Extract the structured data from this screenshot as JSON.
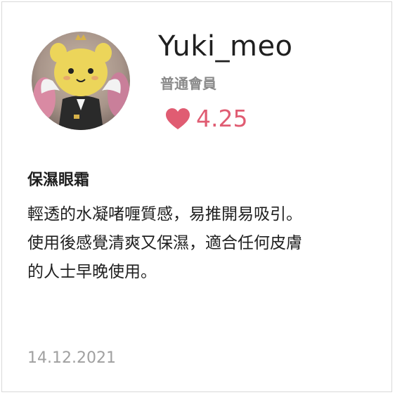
{
  "user": {
    "name": "Yuki_meo",
    "member_type": "普通會員",
    "rating": "4.25",
    "avatar": "yellow-bear-plush-avatar"
  },
  "review": {
    "title": "保濕眼霜",
    "body": "輕透的水凝啫喱質感，易推開易吸引。\n使用後感覺清爽又保濕，適合任何皮膚\n的人士早晚使用。",
    "date": "14.12.2021"
  },
  "colors": {
    "accent": "#e05c72",
    "muted": "#8a8a8a",
    "date": "#a0a0a0",
    "text": "#1f1f1f",
    "border": "#d9d9d9"
  },
  "icons": {
    "rating": "heart-icon"
  }
}
